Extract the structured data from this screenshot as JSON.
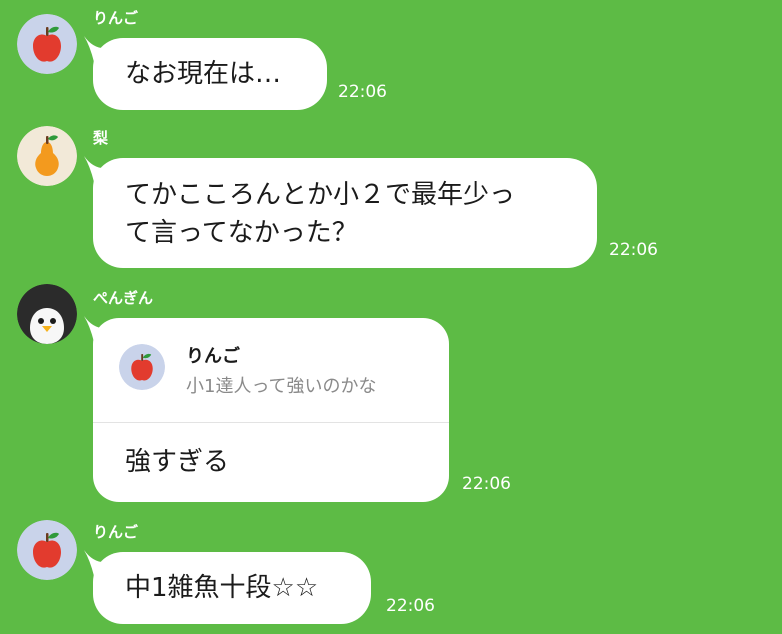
{
  "messages": [
    {
      "sender": "りんご",
      "avatar_icon": "apple-icon",
      "text": "なお現在は…",
      "time": "22:06"
    },
    {
      "sender": "梨",
      "avatar_icon": "pear-icon",
      "lines": [
        "てかこころんとか小２で最年少っ",
        "て言ってなかった？"
      ],
      "time": "22:06"
    },
    {
      "sender": "ぺんぎん",
      "avatar_icon": "penguin-icon",
      "reply": {
        "sender": "りんご",
        "avatar_icon": "apple-icon",
        "text": "小1達人って強いのかな"
      },
      "text": "強すぎる",
      "time": "22:06"
    },
    {
      "sender": "りんご",
      "avatar_icon": "apple-icon",
      "text": "中1雑魚十段☆☆",
      "time": "22:06"
    }
  ],
  "colors": {
    "background": "#5dbb45",
    "bubble": "#ffffff",
    "apple_avatar_bg": "#c9d3ea",
    "pear_avatar_bg": "#f2e9d8",
    "penguin_avatar_bg": "#f3f3f3"
  }
}
